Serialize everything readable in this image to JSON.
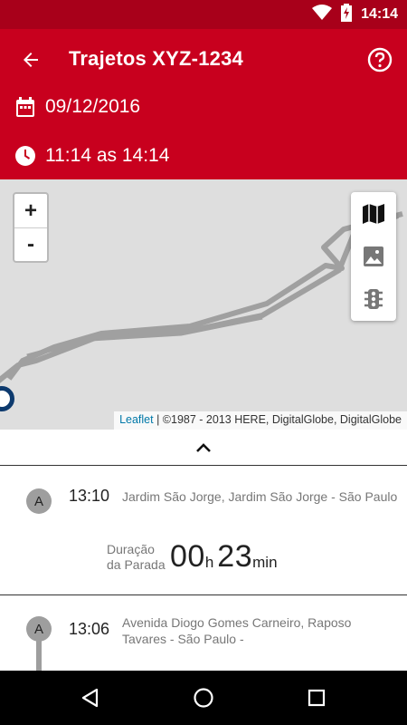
{
  "status_bar": {
    "time": "14:14",
    "icons": [
      "wifi-icon",
      "battery-charging-icon"
    ]
  },
  "header": {
    "title": "Trajetos XYZ-1234",
    "date": "09/12/2016",
    "time_range": "11:14 as 14:14",
    "icons": [
      "back-arrow-icon",
      "help-icon",
      "calendar-icon",
      "clock-icon"
    ]
  },
  "map": {
    "zoom_in_label": "+",
    "zoom_out_label": "-",
    "layer_buttons": [
      "map-icon",
      "image-icon",
      "traffic-light-icon"
    ],
    "attribution_link": "Leaflet",
    "attribution_text": " | ©1987 - 2013 HERE, DigitalGlobe, DigitalGlobe"
  },
  "stops": [
    {
      "marker": "A",
      "time": "13:10",
      "address": "Jardim São Jorge, Jardim São Jorge - São Paulo -",
      "duration_label": "Duração da Parada",
      "duration_hours": "00",
      "duration_hours_unit": "h",
      "duration_minutes": "23",
      "duration_minutes_unit": "min"
    },
    {
      "marker": "A",
      "time": "13:06",
      "address": "Avenida Diogo Gomes Carneiro, Raposo Tavares - São Paulo -"
    }
  ],
  "colors": {
    "primary": "#c8001e",
    "status_bar": "#a8001a",
    "marker": "#9e9e9e",
    "route": "#a0a0a0",
    "map_bg": "#dedede"
  },
  "nav_bar": {
    "icons": [
      "back-triangle-icon",
      "home-circle-icon",
      "recents-square-icon"
    ]
  }
}
